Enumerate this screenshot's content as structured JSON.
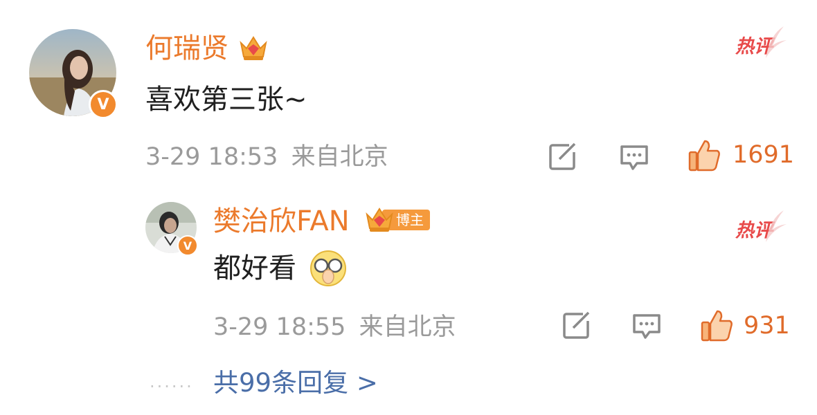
{
  "comment": {
    "username": "何瑞贤",
    "content": "喜欢第三张~",
    "time": "3-29 18:53",
    "location": "来自北京",
    "likes": "1691",
    "hot_label": "热评",
    "avatar_icon": "user-avatar-woman",
    "verified_icon": "verified-v-badge",
    "crown_icon": "vip-crown-icon"
  },
  "reply": {
    "username": "樊治欣FAN",
    "blogger_label": "博主",
    "content": "都好看",
    "emoji_icon": "clapping-glasses-emoji",
    "time": "3-29 18:55",
    "location": "来自北京",
    "likes": "931",
    "hot_label": "热评",
    "avatar_icon": "user-avatar-man",
    "verified_icon": "verified-v-badge",
    "crown_icon": "vip-crown-icon"
  },
  "more_replies": {
    "dots": "......",
    "label": "共99条回复 >"
  },
  "colors": {
    "username": "#eb7a2c",
    "hot": "#e84a4a",
    "link": "#4a6ea8",
    "meta": "#9a9a9a"
  }
}
